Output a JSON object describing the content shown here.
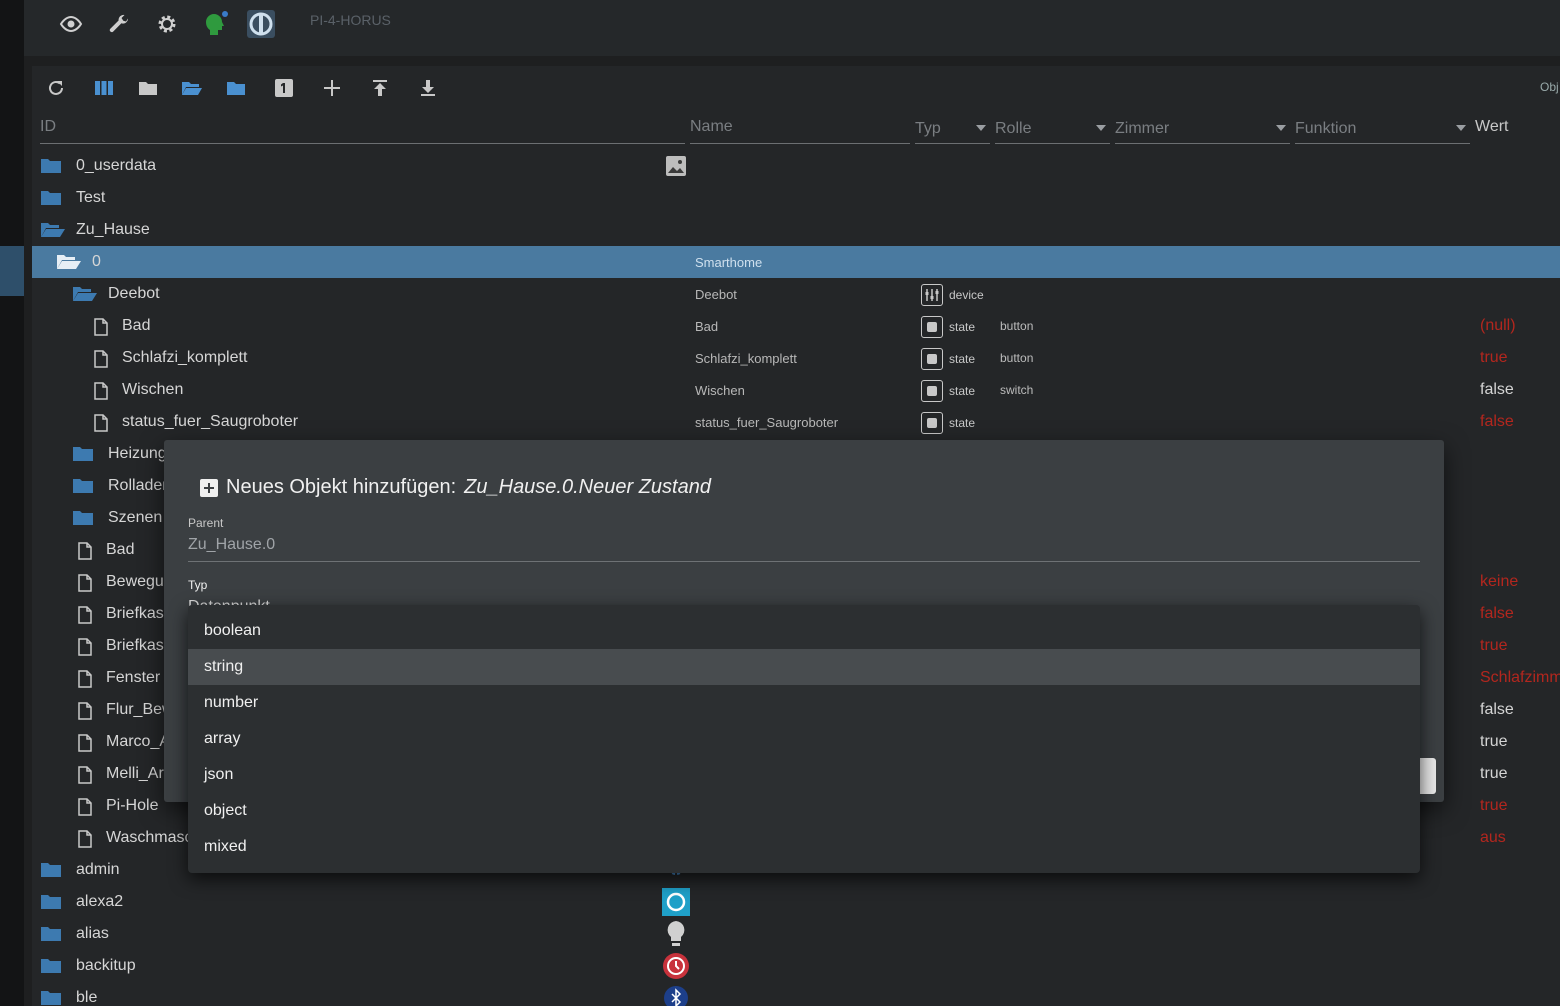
{
  "host": "PI-4-HORUS",
  "toolbar": {
    "obj_label": "Obj"
  },
  "columns": {
    "id": "ID",
    "name": "Name",
    "typ": "Typ",
    "rolle": "Rolle",
    "zimmer": "Zimmer",
    "funktion": "Funktion",
    "wert": "Wert"
  },
  "rows": [
    {
      "id": "0_userdata",
      "name": "",
      "typ": "",
      "role": "",
      "value": ""
    },
    {
      "id": "Test",
      "name": "",
      "typ": "",
      "role": "",
      "value": ""
    },
    {
      "id": "Zu_Hause",
      "name": "",
      "typ": "",
      "role": "",
      "value": ""
    },
    {
      "id": "0",
      "name": "Smarthome",
      "typ": "",
      "role": "",
      "value": ""
    },
    {
      "id": "Deebot",
      "name": "Deebot",
      "typ": "device",
      "role": "",
      "value": ""
    },
    {
      "id": "Bad",
      "name": "Bad",
      "typ": "state",
      "role": "button",
      "value": "(null)"
    },
    {
      "id": "Schlafzi_komplett",
      "name": "Schlafzi_komplett",
      "typ": "state",
      "role": "button",
      "value": "true"
    },
    {
      "id": "Wischen",
      "name": "Wischen",
      "typ": "state",
      "role": "switch",
      "value": "false"
    },
    {
      "id": "status_fuer_Saugroboter",
      "name": "status_fuer_Saugroboter",
      "typ": "state",
      "role": "",
      "value": "false"
    },
    {
      "id": "Heizung",
      "name": "",
      "typ": "",
      "role": "",
      "value": ""
    },
    {
      "id": "Rollader",
      "name": "",
      "typ": "",
      "role": "",
      "value": ""
    },
    {
      "id": "Szenen",
      "name": "",
      "typ": "",
      "role": "",
      "value": ""
    },
    {
      "id": "Bad",
      "name": "",
      "typ": "",
      "role": "",
      "value": ""
    },
    {
      "id": "Bewegu",
      "name": "",
      "typ": "",
      "role": "",
      "value": "keine"
    },
    {
      "id": "Briefkast",
      "name": "",
      "typ": "",
      "role": "",
      "value": "false"
    },
    {
      "id": "Briefkast",
      "name": "",
      "typ": "",
      "role": "",
      "value": "true"
    },
    {
      "id": "Fenster",
      "name": "",
      "typ": "",
      "role": "",
      "value": "Schlafzimm"
    },
    {
      "id": "Flur_Bew",
      "name": "",
      "typ": "",
      "role": "",
      "value": "false"
    },
    {
      "id": "Marco_A",
      "name": "",
      "typ": "",
      "role": "",
      "value": "true"
    },
    {
      "id": "Melli_Ar",
      "name": "",
      "typ": "",
      "role": "",
      "value": "true"
    },
    {
      "id": "Pi-Hole",
      "name": "",
      "typ": "",
      "role": "",
      "value": "true"
    },
    {
      "id": "Waschmasc",
      "name": "",
      "typ": "",
      "role": "",
      "value": "aus"
    },
    {
      "id": "admin",
      "name": "",
      "typ": "",
      "role": "",
      "value": ""
    },
    {
      "id": "alexa2",
      "name": "",
      "typ": "",
      "role": "",
      "value": ""
    },
    {
      "id": "alias",
      "name": "",
      "typ": "",
      "role": "",
      "value": ""
    },
    {
      "id": "backitup",
      "name": "",
      "typ": "",
      "role": "",
      "value": ""
    },
    {
      "id": "ble",
      "name": "",
      "typ": "",
      "role": "",
      "value": ""
    }
  ],
  "dialog": {
    "title_prefix": "Neues Objekt hinzufügen: ",
    "title_path": "Zu_Hause.0.Neuer Zustand",
    "parent_label": "Parent",
    "parent_value": "Zu_Hause.0",
    "typ_label": "Typ",
    "typ_value": "Datenpunkt"
  },
  "type_menu": {
    "options": [
      "boolean",
      "string",
      "number",
      "array",
      "json",
      "object",
      "mixed"
    ],
    "highlighted": "string"
  },
  "colors": {
    "accent": "#4a7aa0",
    "value_red": "#b3261e",
    "folder": "#3d7ab0"
  }
}
